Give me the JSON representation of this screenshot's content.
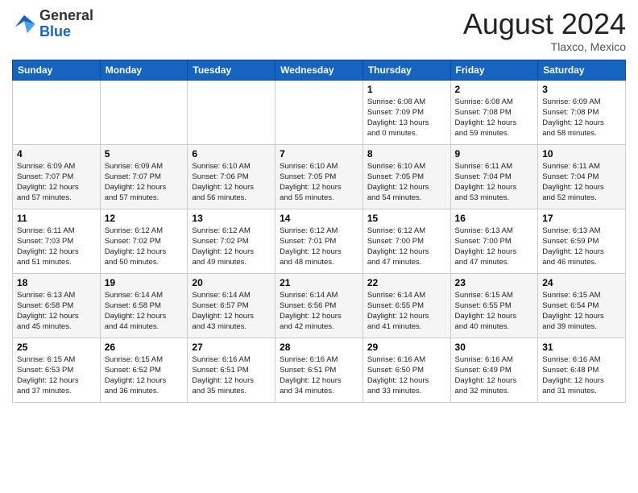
{
  "header": {
    "logo_general": "General",
    "logo_blue": "Blue",
    "month_title": "August 2024",
    "location": "Tlaxco, Mexico"
  },
  "days_of_week": [
    "Sunday",
    "Monday",
    "Tuesday",
    "Wednesday",
    "Thursday",
    "Friday",
    "Saturday"
  ],
  "weeks": [
    [
      {
        "day": "",
        "info": ""
      },
      {
        "day": "",
        "info": ""
      },
      {
        "day": "",
        "info": ""
      },
      {
        "day": "",
        "info": ""
      },
      {
        "day": "1",
        "info": "Sunrise: 6:08 AM\nSunset: 7:09 PM\nDaylight: 13 hours\nand 0 minutes."
      },
      {
        "day": "2",
        "info": "Sunrise: 6:08 AM\nSunset: 7:08 PM\nDaylight: 12 hours\nand 59 minutes."
      },
      {
        "day": "3",
        "info": "Sunrise: 6:09 AM\nSunset: 7:08 PM\nDaylight: 12 hours\nand 58 minutes."
      }
    ],
    [
      {
        "day": "4",
        "info": "Sunrise: 6:09 AM\nSunset: 7:07 PM\nDaylight: 12 hours\nand 57 minutes."
      },
      {
        "day": "5",
        "info": "Sunrise: 6:09 AM\nSunset: 7:07 PM\nDaylight: 12 hours\nand 57 minutes."
      },
      {
        "day": "6",
        "info": "Sunrise: 6:10 AM\nSunset: 7:06 PM\nDaylight: 12 hours\nand 56 minutes."
      },
      {
        "day": "7",
        "info": "Sunrise: 6:10 AM\nSunset: 7:05 PM\nDaylight: 12 hours\nand 55 minutes."
      },
      {
        "day": "8",
        "info": "Sunrise: 6:10 AM\nSunset: 7:05 PM\nDaylight: 12 hours\nand 54 minutes."
      },
      {
        "day": "9",
        "info": "Sunrise: 6:11 AM\nSunset: 7:04 PM\nDaylight: 12 hours\nand 53 minutes."
      },
      {
        "day": "10",
        "info": "Sunrise: 6:11 AM\nSunset: 7:04 PM\nDaylight: 12 hours\nand 52 minutes."
      }
    ],
    [
      {
        "day": "11",
        "info": "Sunrise: 6:11 AM\nSunset: 7:03 PM\nDaylight: 12 hours\nand 51 minutes."
      },
      {
        "day": "12",
        "info": "Sunrise: 6:12 AM\nSunset: 7:02 PM\nDaylight: 12 hours\nand 50 minutes."
      },
      {
        "day": "13",
        "info": "Sunrise: 6:12 AM\nSunset: 7:02 PM\nDaylight: 12 hours\nand 49 minutes."
      },
      {
        "day": "14",
        "info": "Sunrise: 6:12 AM\nSunset: 7:01 PM\nDaylight: 12 hours\nand 48 minutes."
      },
      {
        "day": "15",
        "info": "Sunrise: 6:12 AM\nSunset: 7:00 PM\nDaylight: 12 hours\nand 47 minutes."
      },
      {
        "day": "16",
        "info": "Sunrise: 6:13 AM\nSunset: 7:00 PM\nDaylight: 12 hours\nand 47 minutes."
      },
      {
        "day": "17",
        "info": "Sunrise: 6:13 AM\nSunset: 6:59 PM\nDaylight: 12 hours\nand 46 minutes."
      }
    ],
    [
      {
        "day": "18",
        "info": "Sunrise: 6:13 AM\nSunset: 6:58 PM\nDaylight: 12 hours\nand 45 minutes."
      },
      {
        "day": "19",
        "info": "Sunrise: 6:14 AM\nSunset: 6:58 PM\nDaylight: 12 hours\nand 44 minutes."
      },
      {
        "day": "20",
        "info": "Sunrise: 6:14 AM\nSunset: 6:57 PM\nDaylight: 12 hours\nand 43 minutes."
      },
      {
        "day": "21",
        "info": "Sunrise: 6:14 AM\nSunset: 6:56 PM\nDaylight: 12 hours\nand 42 minutes."
      },
      {
        "day": "22",
        "info": "Sunrise: 6:14 AM\nSunset: 6:55 PM\nDaylight: 12 hours\nand 41 minutes."
      },
      {
        "day": "23",
        "info": "Sunrise: 6:15 AM\nSunset: 6:55 PM\nDaylight: 12 hours\nand 40 minutes."
      },
      {
        "day": "24",
        "info": "Sunrise: 6:15 AM\nSunset: 6:54 PM\nDaylight: 12 hours\nand 39 minutes."
      }
    ],
    [
      {
        "day": "25",
        "info": "Sunrise: 6:15 AM\nSunset: 6:53 PM\nDaylight: 12 hours\nand 37 minutes."
      },
      {
        "day": "26",
        "info": "Sunrise: 6:15 AM\nSunset: 6:52 PM\nDaylight: 12 hours\nand 36 minutes."
      },
      {
        "day": "27",
        "info": "Sunrise: 6:16 AM\nSunset: 6:51 PM\nDaylight: 12 hours\nand 35 minutes."
      },
      {
        "day": "28",
        "info": "Sunrise: 6:16 AM\nSunset: 6:51 PM\nDaylight: 12 hours\nand 34 minutes."
      },
      {
        "day": "29",
        "info": "Sunrise: 6:16 AM\nSunset: 6:50 PM\nDaylight: 12 hours\nand 33 minutes."
      },
      {
        "day": "30",
        "info": "Sunrise: 6:16 AM\nSunset: 6:49 PM\nDaylight: 12 hours\nand 32 minutes."
      },
      {
        "day": "31",
        "info": "Sunrise: 6:16 AM\nSunset: 6:48 PM\nDaylight: 12 hours\nand 31 minutes."
      }
    ]
  ]
}
